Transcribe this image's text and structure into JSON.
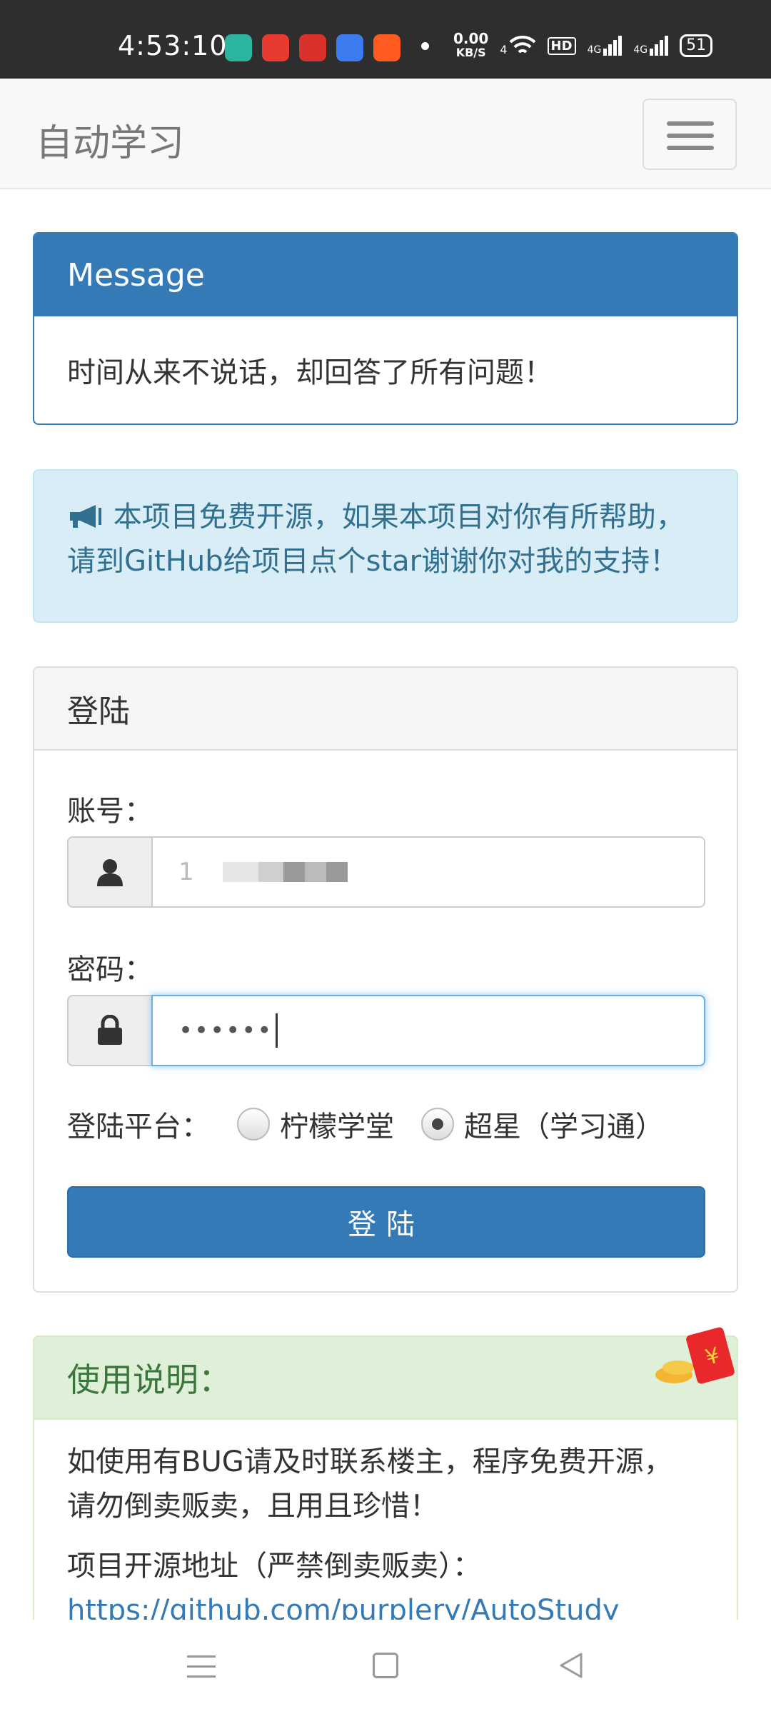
{
  "statusbar": {
    "time": "4:53:10",
    "app_icons": [
      "chat-app-icon",
      "red-app-icon",
      "news-app-icon",
      "paw-app-icon",
      "taobao-app-icon"
    ],
    "speed_value": "0.00",
    "speed_unit": "KB/S",
    "wifi_label": "4",
    "hd_label": "HD",
    "sig1": "4G",
    "sig2": "4G",
    "battery": "51"
  },
  "navbar": {
    "brand": "自动学习"
  },
  "message_panel": {
    "heading": "Message",
    "body": "时间从来不说话，却回答了所有问题！"
  },
  "info_alert": {
    "line1": "本项目免费开源，如果本项目对你有所帮助，",
    "line2": "请到GitHub给项目点个star谢谢你对我的支持！"
  },
  "login_panel": {
    "heading": "登陆",
    "account_label": "账号：",
    "account_value": "1",
    "password_label": "密码：",
    "password_value": "••••••",
    "platform_label": "登陆平台：",
    "options": [
      "柠檬学堂",
      "超星（学习通）"
    ],
    "selected_option": "超星（学习通）",
    "submit": "登陆"
  },
  "help_panel": {
    "heading": "使用说明：",
    "p1_line1": "如使用有BUG请及时联系楼主，程序免费开源，",
    "p1_line2": "请勿倒卖贩卖，且用且珍惜！",
    "p2": "项目开源地址（严禁倒卖贩卖）：",
    "link": "https://github.com/purplery/AutoStudy"
  },
  "colors": {
    "primary": "#337ab7",
    "info_bg": "#d9edf7",
    "info_text": "#31708f",
    "success_bg": "#dff0d8",
    "success_text": "#3c763d"
  }
}
